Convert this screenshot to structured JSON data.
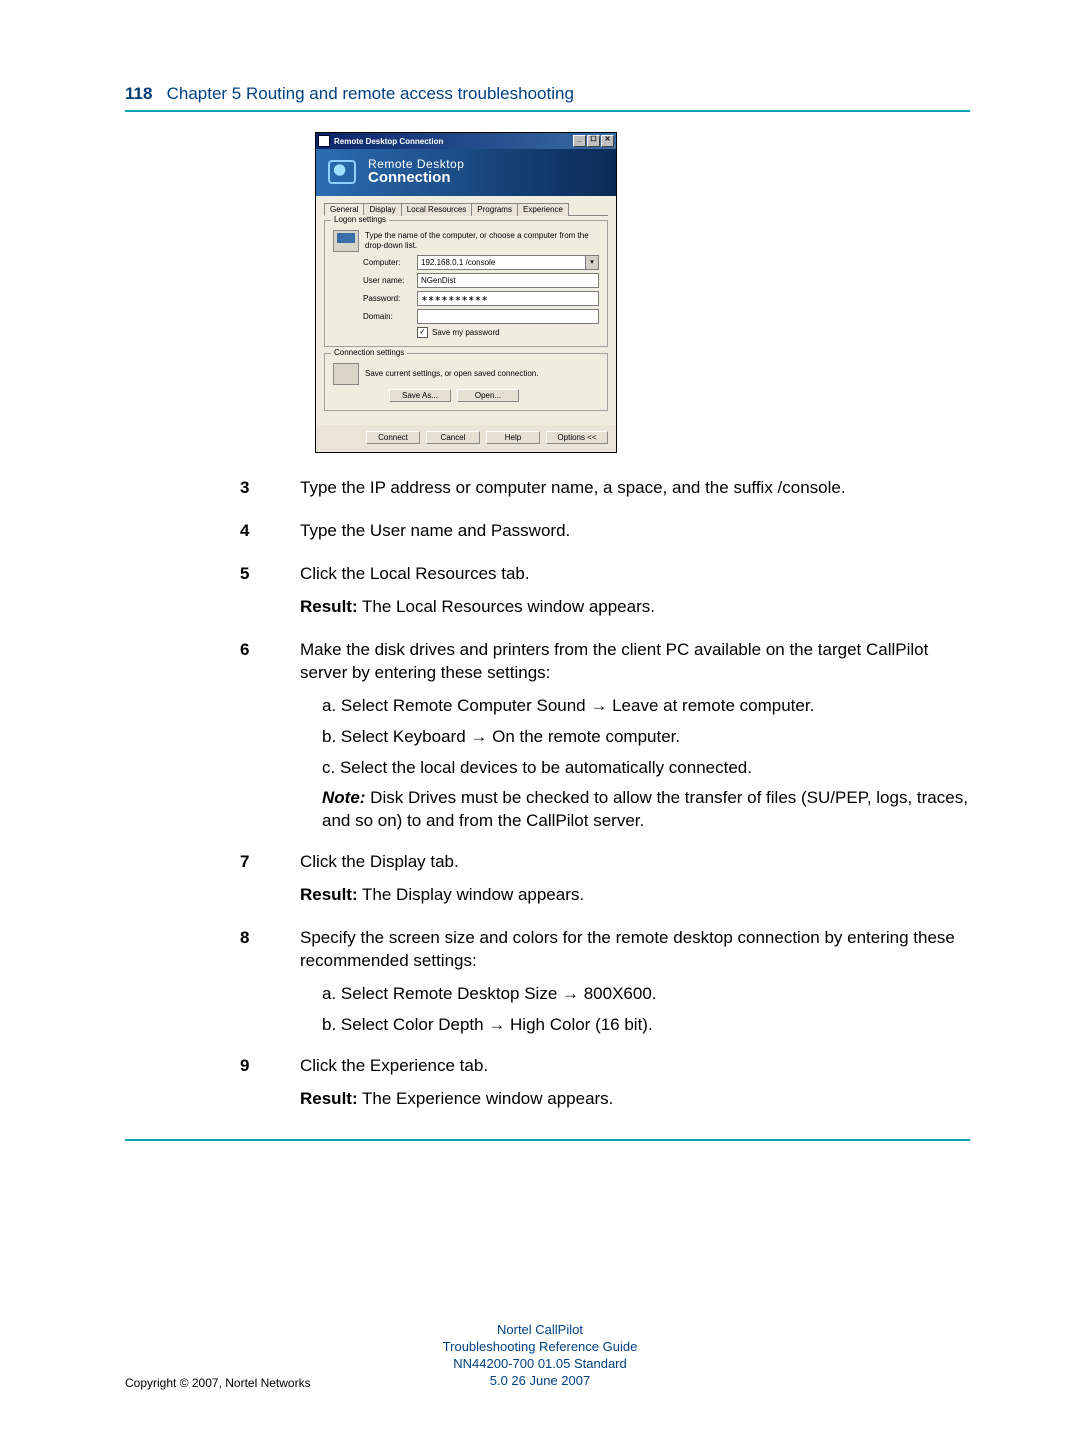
{
  "header": {
    "page_no": "118",
    "title": "Chapter 5  Routing and remote access troubleshooting"
  },
  "dialog": {
    "title": "Remote Desktop Connection",
    "banner_line1": "Remote Desktop",
    "banner_line2": "Connection",
    "tabs": {
      "t0": "General",
      "t1": "Display",
      "t2": "Local Resources",
      "t3": "Programs",
      "t4": "Experience"
    },
    "logon": {
      "legend": "Logon settings",
      "instruction": "Type the name of the computer, or choose a computer from the drop-down list.",
      "labels": {
        "computer": "Computer:",
        "user": "User name:",
        "pass": "Password:",
        "domain": "Domain:"
      },
      "values": {
        "computer": "192.168.0.1 /console",
        "user": "NGenDist",
        "pass": "∗∗∗∗∗∗∗∗∗∗",
        "domain": ""
      },
      "save_pw": "Save my password",
      "save_checked": "✓"
    },
    "conn": {
      "legend": "Connection settings",
      "instruction": "Save current settings, or open saved connection.",
      "save_as": "Save As...",
      "open": "Open..."
    },
    "buttons": {
      "connect": "Connect",
      "cancel": "Cancel",
      "help": "Help",
      "options": "Options <<"
    }
  },
  "steps": {
    "s3": {
      "n": "3",
      "text": "Type the IP address or computer name, a space, and the suffix /console."
    },
    "s4": {
      "n": "4",
      "text": "Type the User name and Password."
    },
    "s5": {
      "n": "5",
      "text": "Click the Local Resources tab.",
      "result_label": "Result:",
      "result_text": " The Local Resources window appears."
    },
    "s6": {
      "n": "6",
      "text": "Make the disk drives and printers from the client PC available on the target CallPilot server by entering these settings:",
      "a": "a.  Select Remote Computer Sound → Leave at remote computer.",
      "b": "b.  Select Keyboard → On the remote computer.",
      "c": "c.  Select the local devices to be automatically connected.",
      "note_label": "Note:",
      "note_text": " Disk Drives must be checked to allow the transfer of files (SU/PEP, logs, traces, and so on) to and from the CallPilot server."
    },
    "s7": {
      "n": "7",
      "text": "Click the Display tab.",
      "result_label": "Result:",
      "result_text": " The Display window appears."
    },
    "s8": {
      "n": "8",
      "text": "Specify the screen size and colors for the remote desktop connection by entering these recommended settings:",
      "a": "a.  Select Remote Desktop Size → 800X600.",
      "b": "b.  Select Color Depth → High Color (16 bit)."
    },
    "s9": {
      "n": "9",
      "text": "Click the Experience tab.",
      "result_label": "Result:",
      "result_text": " The Experience window appears."
    }
  },
  "footer": {
    "l1": "Nortel CallPilot",
    "l2": "Troubleshooting Reference Guide",
    "l3": "NN44200-700   01.05   Standard",
    "l4": "5.0   26 June 2007",
    "copyright": "Copyright © 2007, Nortel Networks"
  }
}
